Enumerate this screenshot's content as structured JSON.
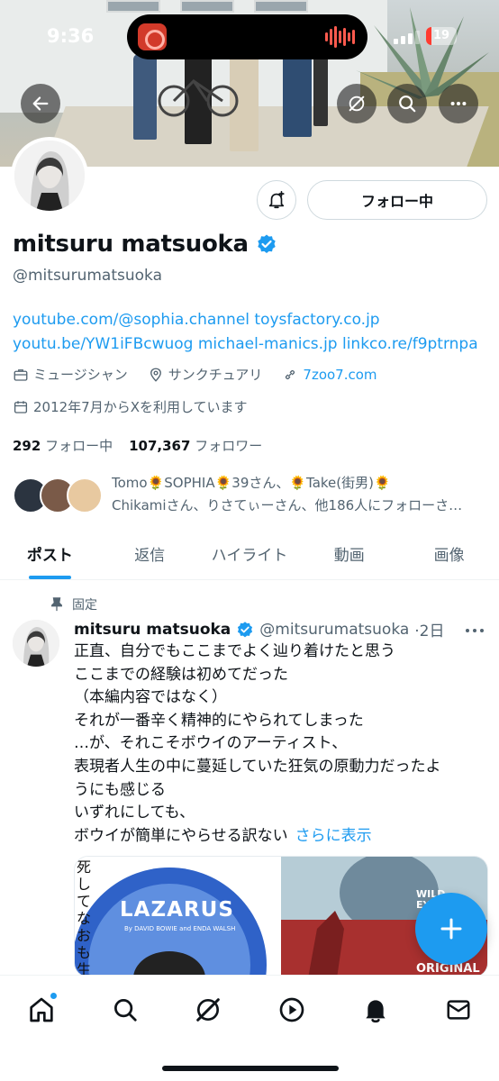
{
  "status_bar": {
    "time": "9:36",
    "battery": "19",
    "battery_level": 0.19
  },
  "header": {
    "back_icon": "arrow-left-icon",
    "actions": [
      "grok-icon",
      "search-icon",
      "more-icon"
    ]
  },
  "profile": {
    "name": "mitsuru matsuoka",
    "handle": "@mitsurumatsuoka",
    "follow_button": "フォロー中",
    "bio": "youtube.com/@sophia.channel toysfactory.co.jp youtu.be/YW1iFBcwuog michael-manics.jp linkco.re/f9ptrnpa",
    "category": "ミュージシャン",
    "location": "サンクチュアリ",
    "website": "7zoo7.com",
    "joined": "2012年7月からXを利用しています",
    "following_count": "292",
    "following_label": "フォロー中",
    "followers_count": "107,367",
    "followers_label": "フォロワー",
    "followed_by_line1": "Tomo🌻SOPHIA🌻39さん、🌻Take(街男)🌻",
    "followed_by_line2": "Chikamiさん、りさてぃーさん、他186人にフォローさ…"
  },
  "tabs": [
    {
      "label": "ポスト",
      "active": true
    },
    {
      "label": "返信",
      "active": false
    },
    {
      "label": "ハイライト",
      "active": false
    },
    {
      "label": "動画",
      "active": false
    },
    {
      "label": "画像",
      "active": false
    }
  ],
  "post": {
    "pinned_label": "固定",
    "author": "mitsuru matsuoka",
    "handle": "@mitsurumatsuoka",
    "time": "·2日",
    "lines": [
      "正直、自分でもここまでよく辿り着けたと思う",
      "ここまでの経験は初めてだった",
      "（本編内容ではなく）",
      "それが一番辛く精神的にやられてしまった",
      "…が、それこそボウイのアーティスト、",
      "表現者人生の中に蔓延していた狂気の原動力だったよ",
      "うにも感じる",
      "いずれにしても、",
      "ボウイが簡単にやらせる訳ない"
    ],
    "show_more": "さらに表示",
    "media1_title": "LAZARUS",
    "media1_side_text": "死してなおも生を問う。",
    "media1_sub": "By DAVID BOWIE and ENDA WALSH",
    "media2_text1": "WILD",
    "media2_text2": "EYE",
    "media2_text3": "ORIGINAL"
  },
  "bottom_nav": [
    "home-icon",
    "search-icon",
    "grok-icon",
    "video-icon",
    "notifications-icon",
    "messages-icon"
  ],
  "colors": {
    "accent": "#1d9bf0",
    "text": "#0f1419",
    "secondary": "#536471",
    "verified": "#1d9bf0"
  }
}
